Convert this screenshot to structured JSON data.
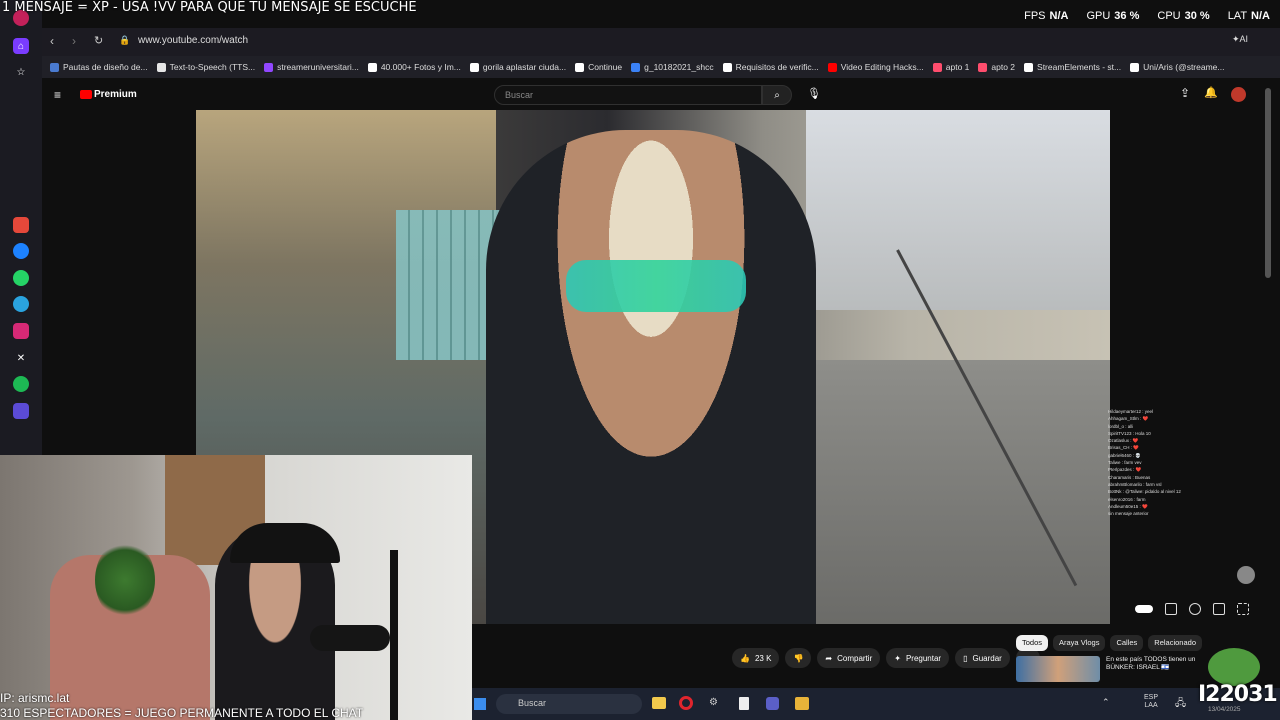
{
  "overlay": {
    "top_banner": "1 MENSAJE = XP - USA !VV PARA QUE TU MENSAJE SE ESCUCHE",
    "ip": "IP: arismc.lat",
    "viewers_goal": "310 ESPECTADORES = JUEGO PERMANENTE A TODO EL CHAT",
    "counter": "I22031"
  },
  "stats": {
    "fps_label": "FPS",
    "fps_value": "N/A",
    "gpu_label": "GPU",
    "gpu_value": "36 %",
    "cpu_label": "CPU",
    "cpu_value": "30 %",
    "lat_label": "LAT",
    "lat_value": "N/A"
  },
  "browser": {
    "url": "www.youtube.com/watch",
    "bookmarks": [
      {
        "label": "Pautas de diseño de...",
        "color": "#4a7bd0"
      },
      {
        "label": "Text-to-Speech (TTS...",
        "color": "#e6e6e6"
      },
      {
        "label": "streameruniversitari...",
        "color": "#9147ff"
      },
      {
        "label": "40.000+ Fotos y Im...",
        "color": "#ffffff"
      },
      {
        "label": "gorila aplastar ciuda...",
        "color": "#ffffff"
      },
      {
        "label": "Continue",
        "color": "#ffffff"
      },
      {
        "label": "g_10182021_shcc",
        "color": "#3b82f6"
      },
      {
        "label": "Requisitos de verific...",
        "color": "#ffffff"
      },
      {
        "label": "Video Editing Hacks...",
        "color": "#ff0000"
      },
      {
        "label": "apto 1",
        "color": "#ff4d6d"
      },
      {
        "label": "apto 2",
        "color": "#ff4d6d"
      },
      {
        "label": "StreamElements - st...",
        "color": "#ffffff"
      },
      {
        "label": "Uni/Aris (@streame...",
        "color": "#ffffff"
      }
    ]
  },
  "youtube": {
    "logo_text": "Premium",
    "search_placeholder": "Buscar",
    "actions": {
      "likes": "23 K",
      "share": "Compartir",
      "ask": "Preguntar",
      "save": "Guardar"
    },
    "chips": [
      "Todos",
      "Araya Vlogs",
      "Calles",
      "Relacionado"
    ],
    "recommendation_title": "En este país TODOS tienen un BÚNKER: ISRAEL 🇮🇱"
  },
  "chat_lines": [
    "Hildaeymarter12 : yeel",
    "Ahhagam_Stlm : ❤️",
    "lordbl_o : alli",
    "SpiritTV123 : Hola 10",
    "Ozatlaslux : ❤️",
    "Brisas_CH : ❤️",
    "gabriel6460 : 💀",
    "Taliwe : farm vev",
    "Pterlpazdes : ❤️",
    "Charamaris : Buenas",
    "abrahmBlomarilo : farm vsl",
    "BottNk : @Taliwe: pidaldo al nivel 12",
    "elsenro2016 : farm",
    "Andleum50e15 : ❤️",
    "sin mensaje anterior"
  ],
  "taskbar": {
    "search_placeholder": "Buscar",
    "lang_line1": "ESP",
    "lang_line2": "LAA",
    "date": "13/04/2025"
  },
  "colors": {
    "youtube_red": "#ff0000",
    "chip_active": "#f1f1f1"
  },
  "icons": {
    "rail": [
      "home-icon",
      "star-icon",
      "gmail-icon",
      "messenger-icon",
      "whatsapp-icon",
      "telegram-icon",
      "instagram-icon",
      "x-icon",
      "spotify-icon",
      "twitch-icon"
    ]
  }
}
